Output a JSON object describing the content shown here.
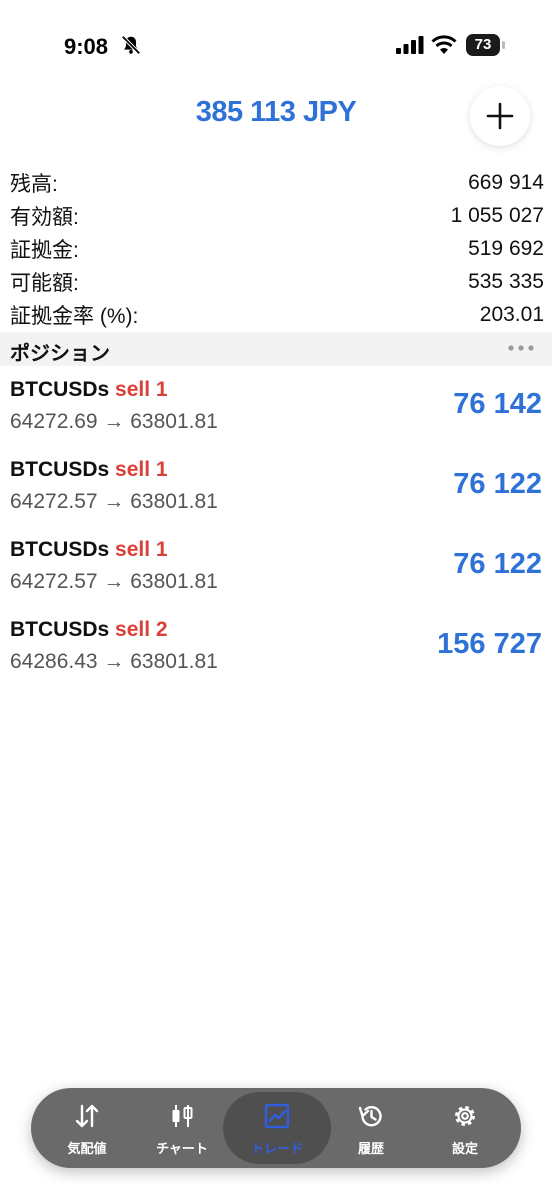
{
  "status_bar": {
    "time": "9:08",
    "battery": "73"
  },
  "header": {
    "balance": "385 113 JPY"
  },
  "summary": [
    {
      "label": "残高:",
      "value": "669 914"
    },
    {
      "label": "有効額:",
      "value": "1 055 027"
    },
    {
      "label": "証拠金:",
      "value": "519 692"
    },
    {
      "label": "可能額:",
      "value": "535 335"
    },
    {
      "label": "証拠金率 (%):",
      "value": "203.01"
    }
  ],
  "positions_section": {
    "title": "ポジション"
  },
  "positions": [
    {
      "symbol": "BTCUSDs",
      "side": "sell 1",
      "prices": "64272.69 → 63801.81",
      "profit": "76 142"
    },
    {
      "symbol": "BTCUSDs",
      "side": "sell 1",
      "prices": "64272.57 → 63801.81",
      "profit": "76 122"
    },
    {
      "symbol": "BTCUSDs",
      "side": "sell 1",
      "prices": "64272.57 → 63801.81",
      "profit": "76 122"
    },
    {
      "symbol": "BTCUSDs",
      "side": "sell 2",
      "prices": "64286.43 → 63801.81",
      "profit": "156 727"
    }
  ],
  "nav": {
    "items": [
      {
        "label": "気配値",
        "icon": "quotes-arrows-icon"
      },
      {
        "label": "チャート",
        "icon": "candlestick-icon"
      },
      {
        "label": "トレード",
        "icon": "trade-chart-icon",
        "active": true
      },
      {
        "label": "履歴",
        "icon": "history-icon"
      },
      {
        "label": "設定",
        "icon": "gear-icon"
      }
    ]
  },
  "colors": {
    "accent_blue": "#2e72d8",
    "sell_red": "#d9413a",
    "nav_active": "#2f5fe0",
    "nav_bg": "#6a6a6a"
  }
}
